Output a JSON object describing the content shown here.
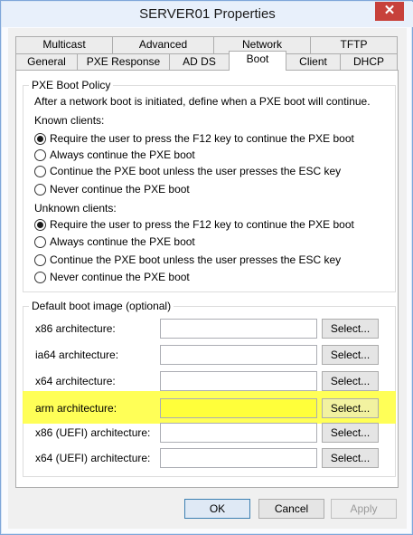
{
  "window": {
    "title": "SERVER01 Properties",
    "close_glyph": "✕"
  },
  "tabs_row1": [
    {
      "label": "Multicast"
    },
    {
      "label": "Advanced"
    },
    {
      "label": "Network"
    },
    {
      "label": "TFTP"
    }
  ],
  "tabs_row2": [
    {
      "label": "General"
    },
    {
      "label": "PXE Response"
    },
    {
      "label": "AD DS"
    },
    {
      "label": "Boot",
      "active": true
    },
    {
      "label": "Client"
    },
    {
      "label": "DHCP"
    }
  ],
  "pxe_policy": {
    "legend": "PXE Boot Policy",
    "description": "After a network boot is initiated, define when a PXE boot will continue.",
    "known_clients": {
      "label": "Known clients:",
      "options": [
        "Require the user to press the F12 key to continue the PXE boot",
        "Always continue the PXE boot",
        "Continue the PXE boot unless the user presses the ESC key",
        "Never continue the PXE boot"
      ],
      "selected_index": 0
    },
    "unknown_clients": {
      "label": "Unknown clients:",
      "options": [
        "Require the user to press the F12 key to continue the PXE boot",
        "Always continue the PXE boot",
        "Continue the PXE boot unless the user presses the ESC key",
        "Never continue the PXE boot"
      ],
      "selected_index": 0
    }
  },
  "default_boot_image": {
    "legend": "Default boot image (optional)",
    "select_label": "Select...",
    "rows": [
      {
        "label": "x86 architecture:",
        "value": ""
      },
      {
        "label": "ia64 architecture:",
        "value": ""
      },
      {
        "label": "x64 architecture:",
        "value": ""
      },
      {
        "label": "arm architecture:",
        "value": ""
      },
      {
        "label": "x86 (UEFI) architecture:",
        "value": ""
      },
      {
        "label": "x64 (UEFI) architecture:",
        "value": ""
      }
    ],
    "highlight_color": "#ffff3a"
  },
  "buttons": {
    "ok": "OK",
    "cancel": "Cancel",
    "apply": "Apply"
  },
  "colors": {
    "titlebar": "#e8f0fb",
    "close_button": "#c7413b",
    "default_button_border": "#3c7fb1"
  }
}
